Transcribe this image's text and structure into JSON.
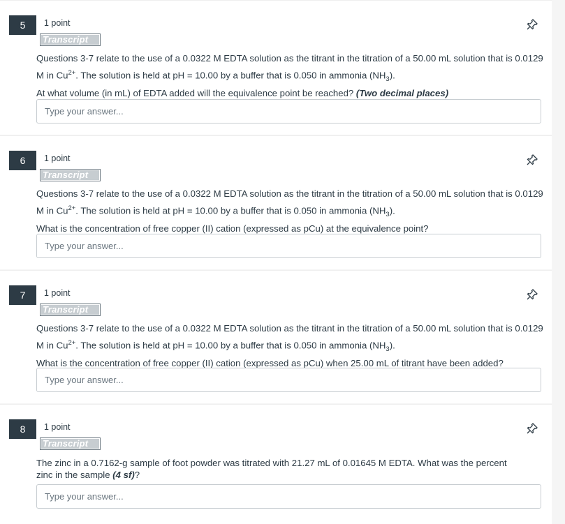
{
  "questions": [
    {
      "number": "5",
      "points": "1 point",
      "transcript_label": "Transcript",
      "text_intro": "Questions 3-7 relate to the use of a 0.0322 M EDTA solution as the titrant in the titration of a 50.00 mL solution that is 0.0129 M in Cu",
      "ion_charge": "2+",
      "text_buffer": ".  The solution is held at pH = 10.00 by a buffer that is 0.050 in ammonia (NH",
      "nh3_sub": "3",
      "text_buffer_end": ").",
      "question": "At what volume (in mL) of EDTA added will the equivalence point be reached? ",
      "emphasis": "(Two decimal places)",
      "placeholder": "Type your answer..."
    },
    {
      "number": "6",
      "points": "1 point",
      "transcript_label": "Transcript",
      "text_intro": "Questions 3-7 relate to the use of a 0.0322 M EDTA solution as the titrant in the titration of a 50.00 mL solution that is 0.0129 M in Cu",
      "ion_charge": "2+",
      "text_buffer": ".  The solution is held at pH = 10.00 by a buffer that is 0.050 in ammonia (NH",
      "nh3_sub": "3",
      "text_buffer_end": ").",
      "question": "What is the concentration of free copper (II) cation (expressed as pCu) at the equivalence point?",
      "placeholder": "Type your answer..."
    },
    {
      "number": "7",
      "points": "1 point",
      "transcript_label": "Transcript",
      "text_intro": "Questions 3-7 relate to the use of a 0.0322 M EDTA solution as the titrant in the titration of a 50.00 mL solution that is 0.0129 M in Cu",
      "ion_charge": "2+",
      "text_buffer": ".  The solution is held at pH = 10.00 by a buffer that is 0.050 in ammonia (NH",
      "nh3_sub": "3",
      "text_buffer_end": ").",
      "question": "What is the concentration of free copper (II) cation (expressed as pCu) when 25.00 mL of titrant have been added?",
      "placeholder": "Type your answer..."
    },
    {
      "number": "8",
      "points": "1 point",
      "transcript_label": "Transcript",
      "text_main": "The zinc in a 0.7162-g sample of foot powder was titrated with 21.27 mL of 0.01645 M EDTA.  What was the percent zinc in the sample ",
      "emphasis": "(4 sf)",
      "text_end": "?",
      "placeholder": "Type your answer..."
    }
  ],
  "icons": {
    "pin": "pin-icon"
  }
}
